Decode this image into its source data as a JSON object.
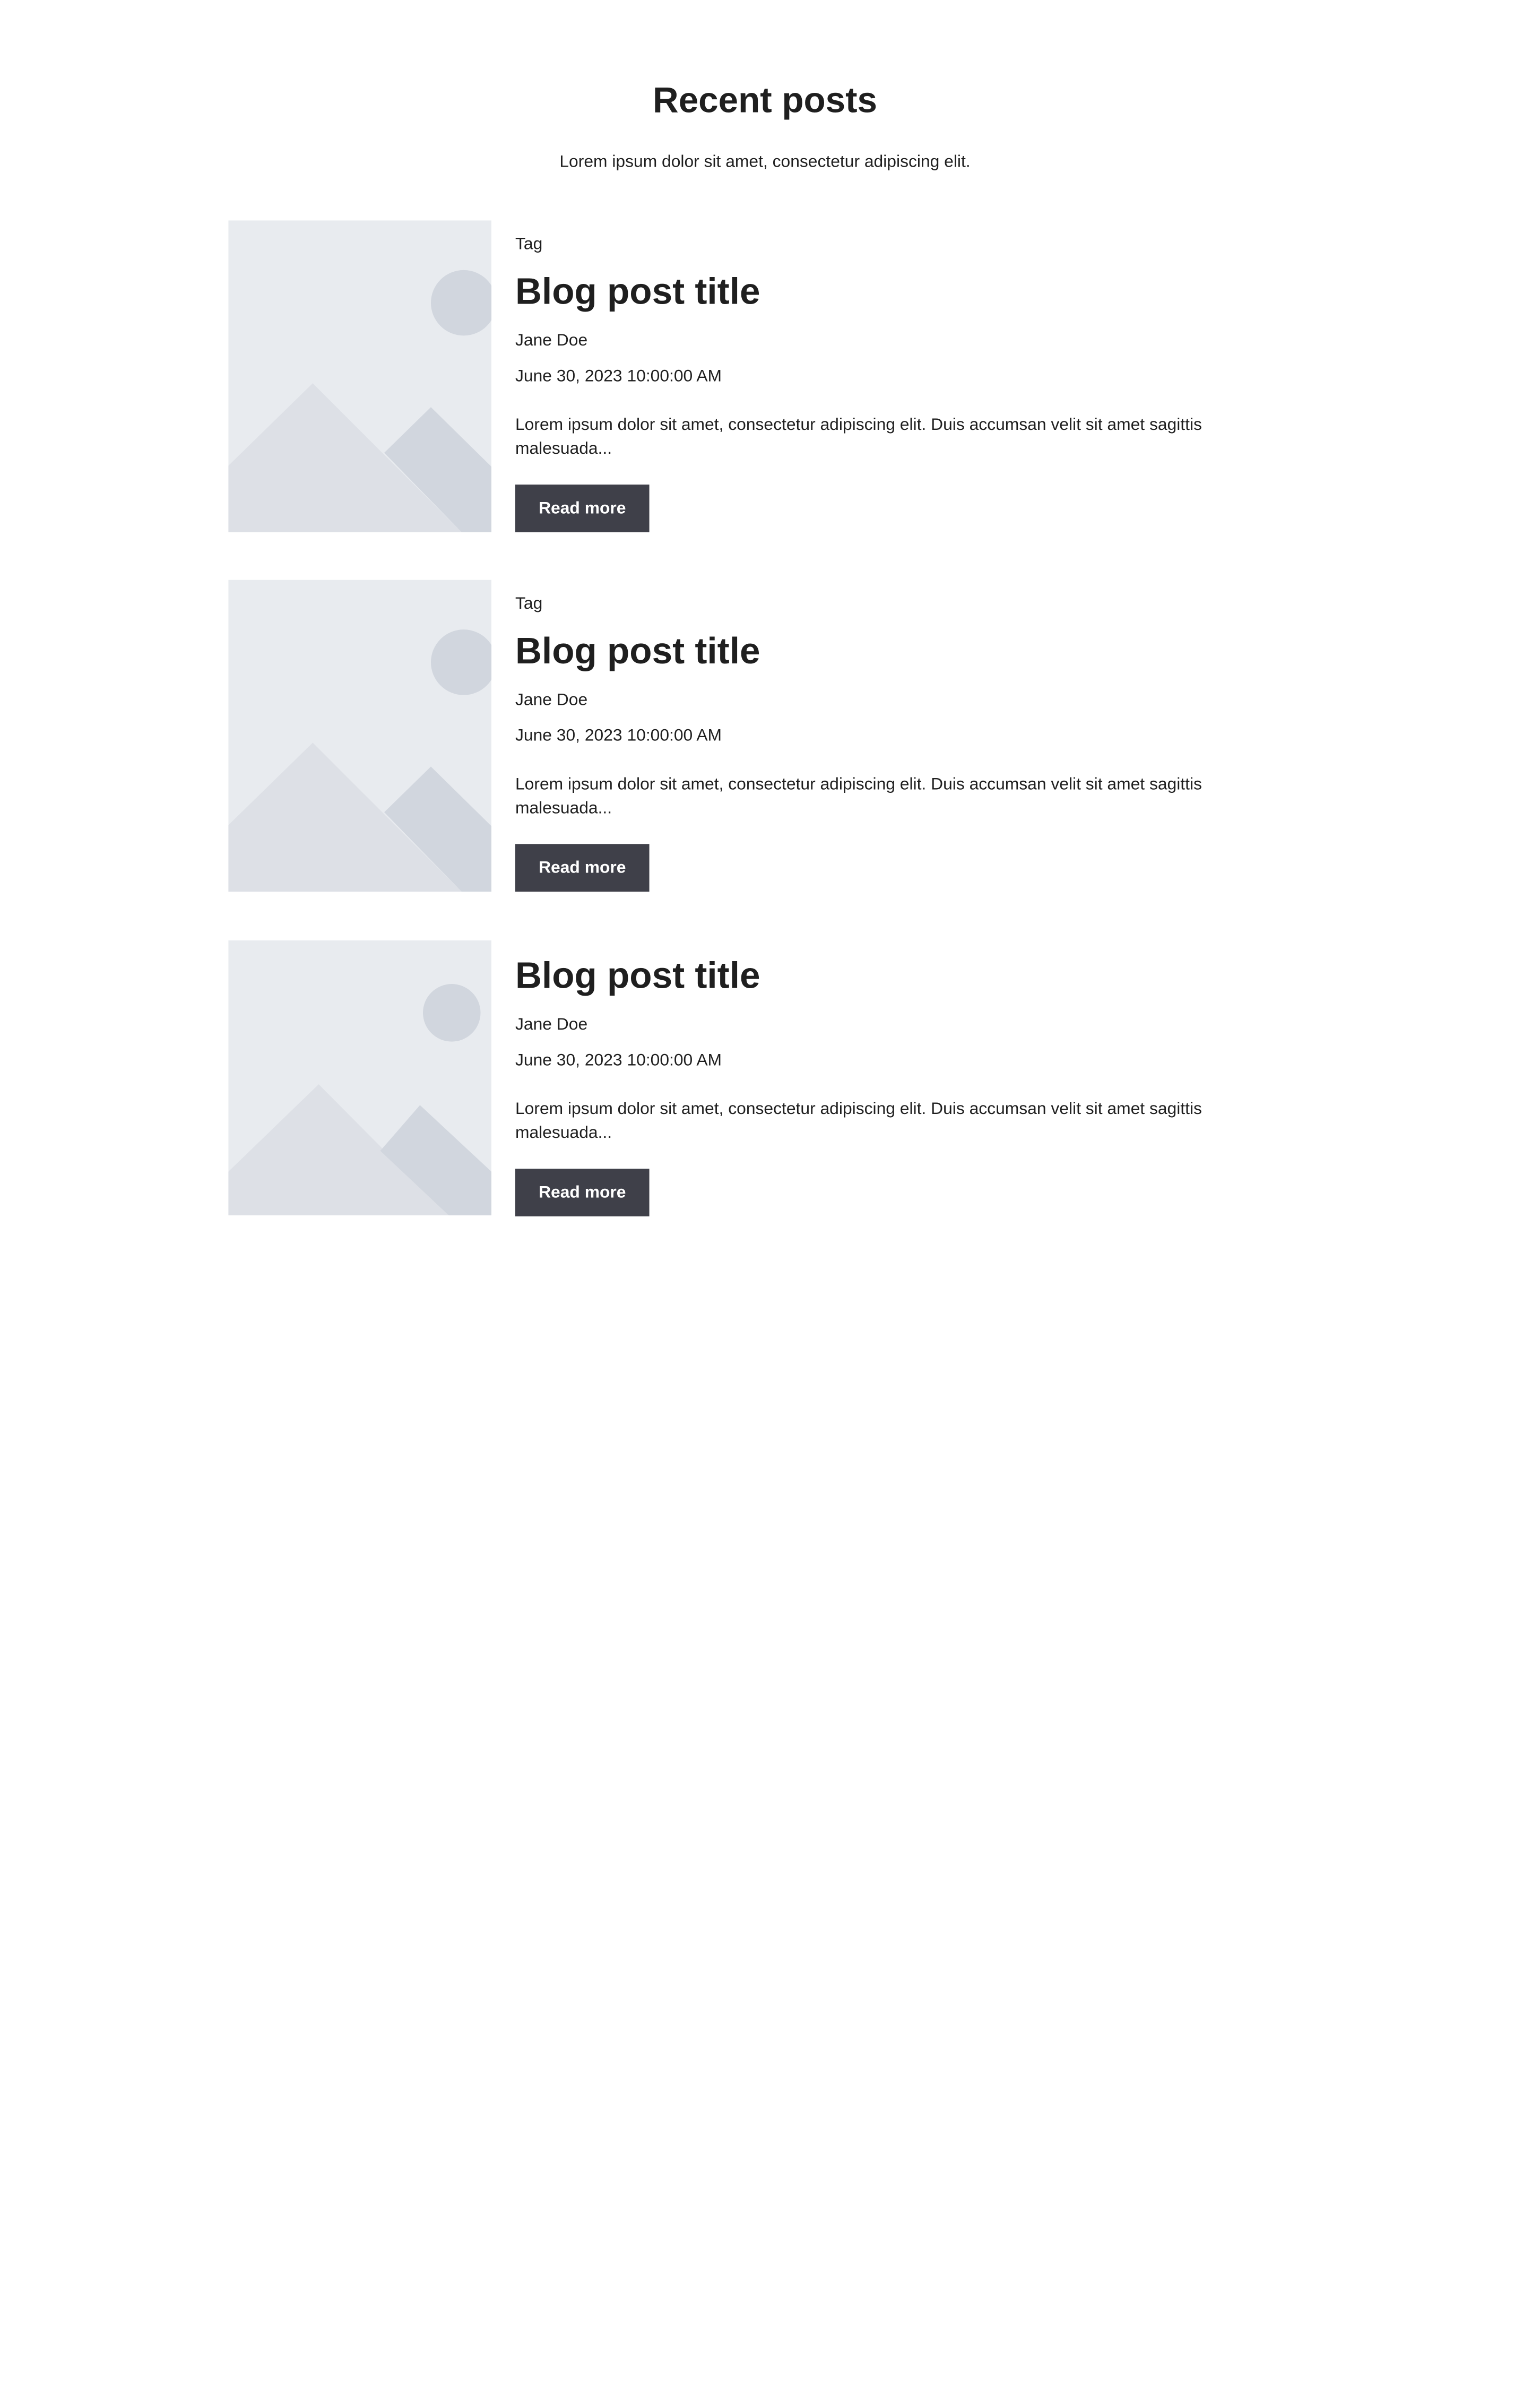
{
  "section": {
    "title": "Recent posts",
    "subtitle": "Lorem ipsum dolor sit amet, consectetur adipiscing elit."
  },
  "colors": {
    "image_bg": "#e8ebef",
    "image_mountain_light": "#dde0e6",
    "image_mountain_dark": "#d1d6de",
    "button_bg": "#3f4049",
    "text": "#1f1f1f"
  },
  "posts": [
    {
      "tag": "Tag",
      "title": "Blog post title",
      "author": "Jane Doe",
      "date": "June 30, 2023 10:00:00 AM",
      "excerpt": "Lorem ipsum dolor sit amet, consectetur adipiscing elit. Duis accumsan velit sit amet sagittis malesuada...",
      "button_label": "Read more",
      "image_icon": "image-placeholder-icon"
    },
    {
      "tag": "Tag",
      "title": "Blog post title",
      "author": "Jane Doe",
      "date": "June 30, 2023 10:00:00 AM",
      "excerpt": "Lorem ipsum dolor sit amet, consectetur adipiscing elit. Duis accumsan velit sit amet sagittis malesuada...",
      "button_label": "Read more",
      "image_icon": "image-placeholder-icon"
    },
    {
      "tag": "",
      "title": "Blog post title",
      "author": "Jane Doe",
      "date": "June 30, 2023 10:00:00 AM",
      "excerpt": "Lorem ipsum dolor sit amet, consectetur adipiscing elit. Duis accumsan velit sit amet sagittis malesuada...",
      "button_label": "Read more",
      "image_icon": "image-placeholder-icon"
    }
  ]
}
